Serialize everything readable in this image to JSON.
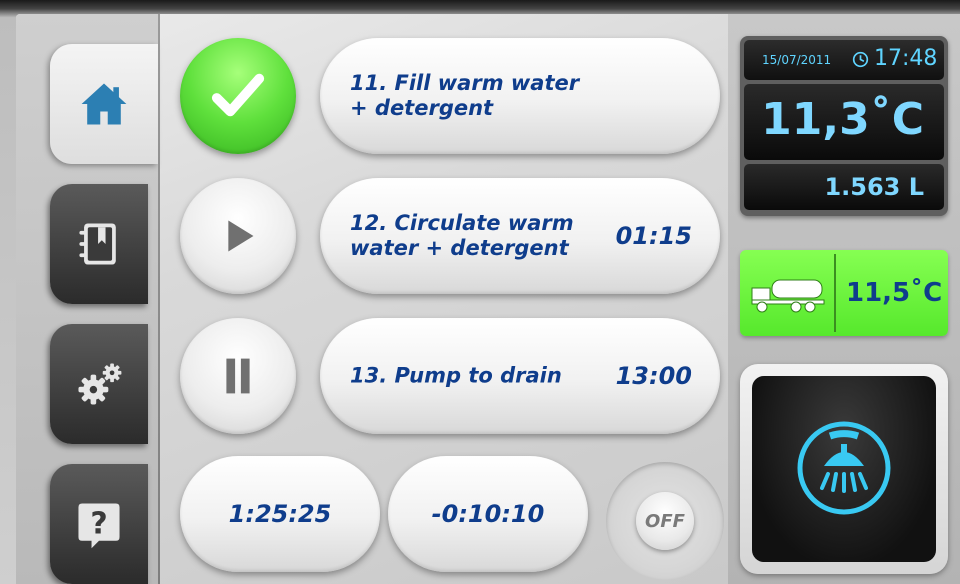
{
  "sidebar": {
    "tabs": [
      {
        "name": "home",
        "icon": "home-icon",
        "active": true
      },
      {
        "name": "logbook",
        "icon": "bookmark-book-icon",
        "active": false
      },
      {
        "name": "settings",
        "icon": "gears-icon",
        "active": false
      },
      {
        "name": "help",
        "icon": "help-icon",
        "active": false
      }
    ]
  },
  "steps": [
    {
      "line1": "11. Fill warm water",
      "line2": "+ detergent",
      "time": "",
      "status": "done",
      "status_icon": "checkmark-icon"
    },
    {
      "line1": "12. Circulate warm",
      "line2": "water + detergent",
      "time": "01:15",
      "status": "play",
      "status_icon": "play-icon"
    },
    {
      "line1": "13. Pump to drain",
      "line2": "",
      "time": "13:00",
      "status": "pause",
      "status_icon": "pause-icon"
    }
  ],
  "timers": {
    "elapsed": "1:25:25",
    "remaining": "-0:10:10"
  },
  "off_label": "OFF",
  "status": {
    "date": "15/07/2011",
    "time": "17:48",
    "temperature": "11,3˚C",
    "volume": "1.563 L"
  },
  "tank": {
    "icon": "tank-truck-icon",
    "temperature": "11,5˚C"
  },
  "wash": {
    "icon": "shower-icon"
  },
  "colors": {
    "accent_blue": "#0f3d8c",
    "display_cyan": "#7fd7ff",
    "ok_green": "#5fe03c"
  }
}
